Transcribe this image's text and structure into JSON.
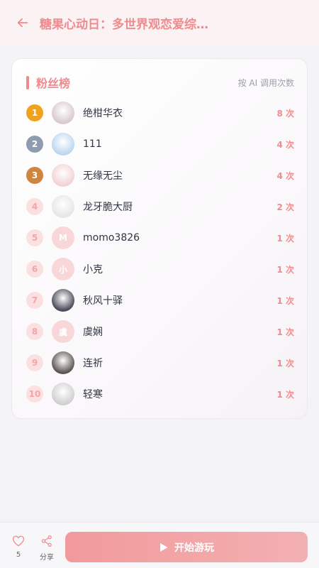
{
  "header": {
    "title": "糖果心动日：多世界观恋爱综…"
  },
  "ranking": {
    "title": "粉丝榜",
    "subtitle": "按 AI 调用次数",
    "entries": [
      {
        "rank": "1",
        "name": "绝柑华衣",
        "count": "8 次",
        "medal": "gold",
        "avatar": "photo",
        "avatar_color": "#d9c8cc"
      },
      {
        "rank": "2",
        "name": "111",
        "count": "4 次",
        "medal": "silver",
        "avatar": "photo",
        "avatar_color": "#bcd6f0"
      },
      {
        "rank": "3",
        "name": "无缘无尘",
        "count": "4 次",
        "medal": "bronze",
        "avatar": "photo",
        "avatar_color": "#f3d1d4"
      },
      {
        "rank": "4",
        "name": "龙牙脆大厨",
        "count": "2 次",
        "medal": "plain",
        "avatar": "photo",
        "avatar_color": "#e6e6e6"
      },
      {
        "rank": "5",
        "name": "momo3826",
        "count": "1 次",
        "medal": "plain",
        "avatar": "M",
        "avatar_color": "#f9d7d9"
      },
      {
        "rank": "6",
        "name": "小克",
        "count": "1 次",
        "medal": "plain",
        "avatar": "小",
        "avatar_color": "#f9d7d9"
      },
      {
        "rank": "7",
        "name": "秋风十驿",
        "count": "1 次",
        "medal": "plain",
        "avatar": "photo",
        "avatar_color": "#4a4a58"
      },
      {
        "rank": "8",
        "name": "虞娴",
        "count": "1 次",
        "medal": "plain",
        "avatar": "虞",
        "avatar_color": "#f9d7d9"
      },
      {
        "rank": "9",
        "name": "连祈",
        "count": "1 次",
        "medal": "plain",
        "avatar": "photo",
        "avatar_color": "#5b5350"
      },
      {
        "rank": "10",
        "name": "轻寒",
        "count": "1 次",
        "medal": "plain",
        "avatar": "photo",
        "avatar_color": "#cfcfcf"
      }
    ]
  },
  "footer": {
    "like_count": "5",
    "share_label": "分享",
    "start_label": "开始游玩"
  },
  "colors": {
    "accent": "#ef8b8e",
    "gold": "#f2a21a",
    "silver": "#8e9bb0",
    "bronze": "#d0853f"
  },
  "icons": {
    "back": "arrow-left-icon",
    "like": "heart-icon",
    "share": "share-icon",
    "start": "play-icon"
  }
}
